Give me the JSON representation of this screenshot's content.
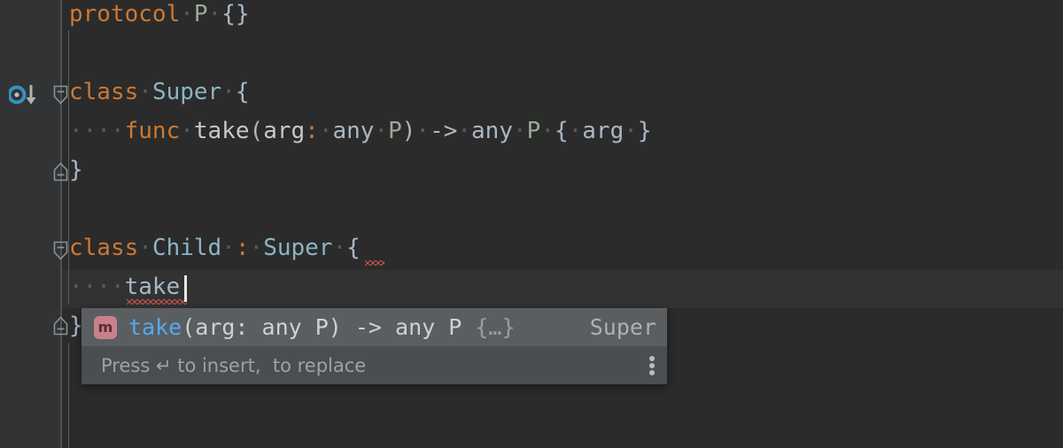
{
  "app": {
    "kind": "code-editor",
    "language": "Swift",
    "theme": "Darcula",
    "editor_bg": "#2b2b2b",
    "gutter_bg": "#313335",
    "caret_line_bg": "#323232"
  },
  "colors": {
    "keyword": "#cc7832",
    "type": "#8cb4c4",
    "protocol": "#9aab97",
    "identifier": "#c8c8c8",
    "punctuation": "#a9b7c6",
    "error_underline": "#c75450",
    "popup_selected_bg": "#5b5e60",
    "popup_hint_bg": "#4b4e50",
    "popup_name": "#56a8f5",
    "badge_bg": "#c8818c",
    "override_icon": "#3592c4"
  },
  "gutter": {
    "icons": [
      {
        "name": "overridden-method-icon",
        "tooltip_line": 3
      }
    ],
    "fold_markers": [
      {
        "name": "fold-collapse-open",
        "line": 3
      },
      {
        "name": "fold-collapse-close",
        "line": 5
      },
      {
        "name": "fold-collapse-open",
        "line": 7
      },
      {
        "name": "fold-collapse-close",
        "line": 9
      }
    ]
  },
  "code": {
    "lines": [
      {
        "num": 1,
        "tokens": [
          {
            "t": "protocol",
            "c": "kw"
          },
          {
            "t": "·",
            "c": "ws"
          },
          {
            "t": "P",
            "c": "prot"
          },
          {
            "t": "·",
            "c": "ws"
          },
          {
            "t": "{}",
            "c": "punc"
          }
        ]
      },
      {
        "num": 2,
        "tokens": []
      },
      {
        "num": 3,
        "tokens": [
          {
            "t": "class",
            "c": "kw"
          },
          {
            "t": "·",
            "c": "ws"
          },
          {
            "t": "Super",
            "c": "type"
          },
          {
            "t": "·",
            "c": "ws"
          },
          {
            "t": "{",
            "c": "punc"
          }
        ]
      },
      {
        "num": 4,
        "tokens": [
          {
            "t": "····",
            "c": "ws"
          },
          {
            "t": "func",
            "c": "kw"
          },
          {
            "t": "·",
            "c": "ws"
          },
          {
            "t": "take",
            "c": "id"
          },
          {
            "t": "(",
            "c": "punc"
          },
          {
            "t": "arg",
            "c": "id"
          },
          {
            "t": ":",
            "c": "kw"
          },
          {
            "t": "·",
            "c": "ws"
          },
          {
            "t": "any",
            "c": "punc"
          },
          {
            "t": "·",
            "c": "ws"
          },
          {
            "t": "P",
            "c": "prot"
          },
          {
            "t": ")",
            "c": "punc"
          },
          {
            "t": "·",
            "c": "ws"
          },
          {
            "t": "->",
            "c": "op"
          },
          {
            "t": "·",
            "c": "ws"
          },
          {
            "t": "any",
            "c": "punc"
          },
          {
            "t": "·",
            "c": "ws"
          },
          {
            "t": "P",
            "c": "prot"
          },
          {
            "t": "·",
            "c": "ws"
          },
          {
            "t": "{",
            "c": "punc"
          },
          {
            "t": "·",
            "c": "ws"
          },
          {
            "t": "arg",
            "c": "punc"
          },
          {
            "t": "·",
            "c": "ws"
          },
          {
            "t": "}",
            "c": "punc"
          }
        ]
      },
      {
        "num": 5,
        "tokens": [
          {
            "t": "}",
            "c": "punc"
          }
        ]
      },
      {
        "num": 6,
        "tokens": []
      },
      {
        "num": 7,
        "tokens": [
          {
            "t": "class",
            "c": "kw"
          },
          {
            "t": "·",
            "c": "ws"
          },
          {
            "t": "Child",
            "c": "type"
          },
          {
            "t": "·",
            "c": "ws"
          },
          {
            "t": ":",
            "c": "kw"
          },
          {
            "t": "·",
            "c": "ws"
          },
          {
            "t": "Super",
            "c": "type"
          },
          {
            "t": "·",
            "c": "ws"
          },
          {
            "t": "{",
            "c": "punc"
          }
        ]
      },
      {
        "num": 8,
        "tokens": [
          {
            "t": "····",
            "c": "ws"
          },
          {
            "t": "take",
            "c": "punc"
          }
        ]
      },
      {
        "num": 9,
        "tokens": [
          {
            "t": "}",
            "c": "punc"
          }
        ]
      }
    ],
    "plain": [
      "protocol P {}",
      "",
      "class Super {",
      "    func take(arg: any P) -> any P { arg }",
      "}",
      "",
      "class Child : Super {",
      "    take",
      "}"
    ],
    "caret": {
      "line": 8,
      "column": 9
    },
    "errors": [
      {
        "line": 7,
        "note": "squiggle after opening brace"
      },
      {
        "line": 8,
        "note": "squiggle under 'take'"
      }
    ]
  },
  "completion_popup": {
    "name": "code-completion-popup",
    "items": [
      {
        "icon": "m",
        "icon_name": "method-icon",
        "name": "take",
        "signature": "(arg: any P) -> any P",
        "body": "{…}",
        "owner": "Super",
        "selected": true
      }
    ],
    "hint": "Press ↵ to insert,  to replace",
    "menu_icon": "kebab-menu-icon"
  }
}
